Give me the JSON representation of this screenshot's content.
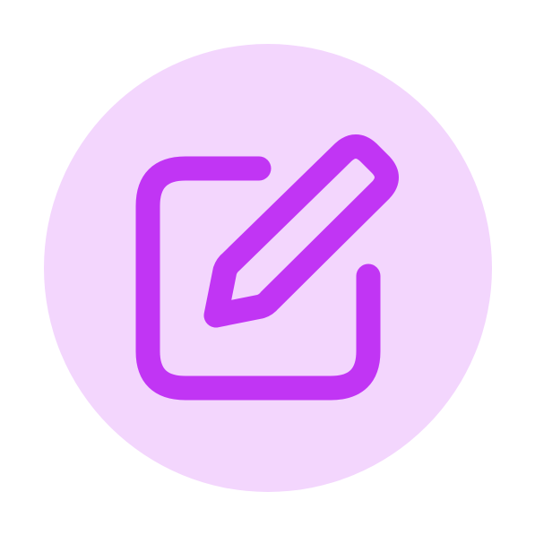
{
  "icon": {
    "name": "edit-icon",
    "colors": {
      "background_circle": "#f3d6fd",
      "stroke": "#c135f4",
      "page": "#ffffff"
    }
  }
}
